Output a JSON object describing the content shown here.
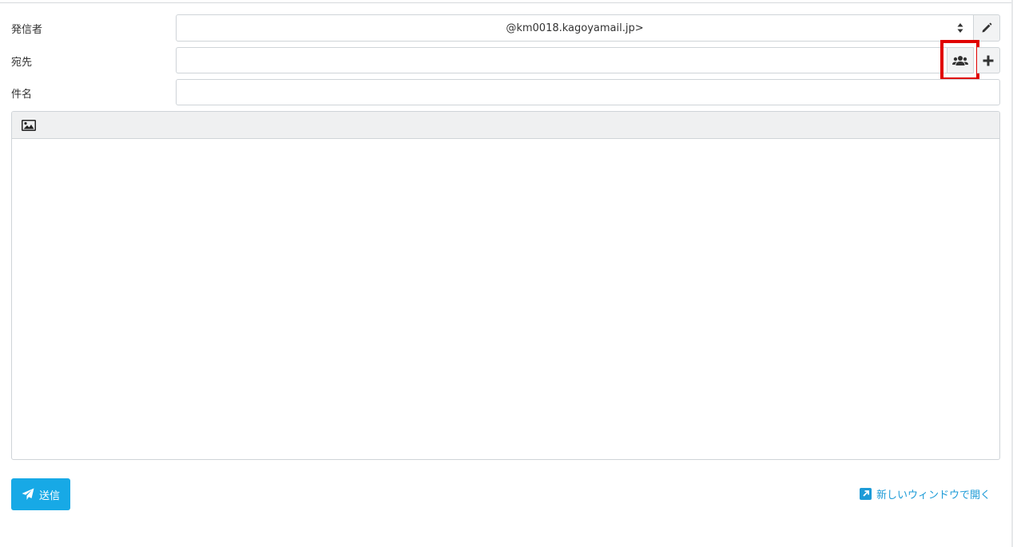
{
  "compose": {
    "from_label": "発信者",
    "from_value": "@km0018.kagoyamail.jp>",
    "to_label": "宛先",
    "to_value": "",
    "subject_label": "件名",
    "subject_value": ""
  },
  "icons": {
    "edit": "pencil-icon",
    "contacts": "users-icon",
    "add": "plus-icon",
    "image": "image-icon",
    "send": "paper-plane-icon",
    "new_window": "external-link-icon"
  },
  "actions": {
    "send_label": "送信",
    "new_window_label": "新しいウィンドウで開く"
  },
  "colors": {
    "send_button": "#17a9e6",
    "link": "#1d9bd7",
    "highlight": "#e00000"
  }
}
